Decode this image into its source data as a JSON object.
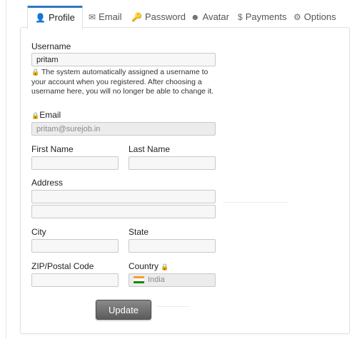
{
  "tabs": [
    {
      "label": "Profile",
      "icon": "user-icon",
      "active": true
    },
    {
      "label": "Email",
      "icon": "envelope-icon"
    },
    {
      "label": "Password",
      "icon": "key-icon"
    },
    {
      "label": "Avatar",
      "icon": "avatar-icon"
    },
    {
      "label": "Payments",
      "icon": "dollar-icon"
    },
    {
      "label": "Options",
      "icon": "gear-icon"
    }
  ],
  "form": {
    "username_label": "Username",
    "username_value": "pritam",
    "username_hint": "The system automatically assigned a username to your account when you registered. After choosing a username here, you will no longer be able to change it.",
    "email_label": "Email",
    "email_value": "pritam@surejob.in",
    "first_name_label": "First Name",
    "first_name_value": "",
    "last_name_label": "Last Name",
    "last_name_value": "",
    "address_label": "Address",
    "address_line1": "",
    "address_line2": "",
    "city_label": "City",
    "city_value": "",
    "state_label": "State",
    "state_value": "",
    "zip_label": "ZIP/Postal Code",
    "zip_value": "",
    "country_label": "Country",
    "country_value": "India",
    "update_button": "Update"
  },
  "colors": {
    "accent": "#2a78c8",
    "button": "#6b6b6b"
  }
}
